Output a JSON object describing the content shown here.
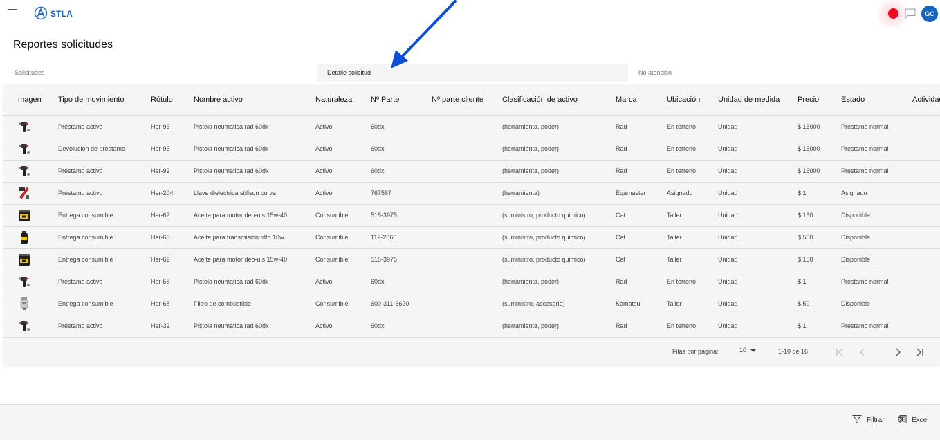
{
  "app": {
    "brand": "STLA",
    "avatar_initials": "GC",
    "accent": "#1565c0",
    "record_color": "#ee0b22"
  },
  "page": {
    "title": "Reportes solicitudes"
  },
  "tabs": [
    {
      "label": "Solicitudes",
      "active": false
    },
    {
      "label": "Detalle solicitud",
      "active": true
    },
    {
      "label": "No atención",
      "active": false
    }
  ],
  "table": {
    "columns": [
      "Imagen",
      "Tipo de movimiento",
      "Rótulo",
      "Nombre activo",
      "Naturaleza",
      "Nº Parte",
      "Nº parte cliente",
      "Clasificación de activo",
      "Marca",
      "Ubicación",
      "Unidad de medida",
      "Precio",
      "Estado",
      "Actividad"
    ],
    "rows": [
      {
        "image": "pneumatic-gun",
        "tipo": "Préstamo activo",
        "rotulo": "Her-93",
        "nombre": "Pistola neumatica rad 60dx",
        "naturaleza": "Activo",
        "parte": "60dx",
        "parte_cliente": "",
        "clasificacion": "(herramienta, poder)",
        "marca": "Rad",
        "ubicacion": "En terreno",
        "unidad": "Unidad",
        "precio": "$ 15000",
        "estado": "Prestamo normal"
      },
      {
        "image": "pneumatic-gun",
        "tipo": "Devolución de préstamo",
        "rotulo": "Her-93",
        "nombre": "Pistola neumatica rad 60dx",
        "naturaleza": "Activo",
        "parte": "60dx",
        "parte_cliente": "",
        "clasificacion": "(herramienta, poder)",
        "marca": "Rad",
        "ubicacion": "En terreno",
        "unidad": "Unidad",
        "precio": "$ 15000",
        "estado": "Prestamo normal"
      },
      {
        "image": "pneumatic-gun",
        "tipo": "Préstamo activo",
        "rotulo": "Her-92",
        "nombre": "Pistola neumatica rad 60dx",
        "naturaleza": "Activo",
        "parte": "60dx",
        "parte_cliente": "",
        "clasificacion": "(herramienta, poder)",
        "marca": "Rad",
        "ubicacion": "En terreno",
        "unidad": "Unidad",
        "precio": "$ 15000",
        "estado": "Prestamo normal"
      },
      {
        "image": "wrench",
        "tipo": "Préstamo activo",
        "rotulo": "Her-204",
        "nombre": "Llave dielectrica stillson curva",
        "naturaleza": "Activo",
        "parte": "767587",
        "parte_cliente": "",
        "clasificacion": "(herramienta)",
        "marca": "Egamaster",
        "ubicacion": "Asignado",
        "unidad": "Unidad",
        "precio": "$ 1",
        "estado": "Asignado"
      },
      {
        "image": "oil-bucket",
        "tipo": "Entrega consumible",
        "rotulo": "Her-62",
        "nombre": "Aceite para motor deo-uls 15w-40",
        "naturaleza": "Consumible",
        "parte": "515-3975",
        "parte_cliente": "",
        "clasificacion": "(suministro, producto quimico)",
        "marca": "Cat",
        "ubicacion": "Taller",
        "unidad": "Unidad",
        "precio": "$ 150",
        "estado": "Disponible"
      },
      {
        "image": "oil-bottle",
        "tipo": "Entrega consumible",
        "rotulo": "Her-63",
        "nombre": "Aceite para transmision tdto 10w",
        "naturaleza": "Consumible",
        "parte": "112-2866",
        "parte_cliente": "",
        "clasificacion": "(suministro, producto quimico)",
        "marca": "Cat",
        "ubicacion": "Taller",
        "unidad": "Unidad",
        "precio": "$ 500",
        "estado": "Disponible"
      },
      {
        "image": "oil-bucket",
        "tipo": "Entrega consumible",
        "rotulo": "Her-62",
        "nombre": "Aceite para motor deo-uls 15w-40",
        "naturaleza": "Consumible",
        "parte": "515-3975",
        "parte_cliente": "",
        "clasificacion": "(suministro, producto quimico)",
        "marca": "Cat",
        "ubicacion": "Taller",
        "unidad": "Unidad",
        "precio": "$ 150",
        "estado": "Disponible"
      },
      {
        "image": "pneumatic-gun",
        "tipo": "Préstamo activo",
        "rotulo": "Her-58",
        "nombre": "Pistola neumatica rad 60dx",
        "naturaleza": "Activo",
        "parte": "60dx",
        "parte_cliente": "",
        "clasificacion": "(herramienta, poder)",
        "marca": "Rad",
        "ubicacion": "En terreno",
        "unidad": "Unidad",
        "precio": "$ 1",
        "estado": "Prestamo normal"
      },
      {
        "image": "fuel-filter",
        "tipo": "Entrega consumible",
        "rotulo": "Her-68",
        "nombre": "Filtro de combustible",
        "naturaleza": "Consumible",
        "parte": "600-311-3620",
        "parte_cliente": "",
        "clasificacion": "(suministro, accesorio)",
        "marca": "Komatsu",
        "ubicacion": "Taller",
        "unidad": "Unidad",
        "precio": "$ 50",
        "estado": "Disponible"
      },
      {
        "image": "pneumatic-gun",
        "tipo": "Préstamo activo",
        "rotulo": "Her-32",
        "nombre": "Pistola neumatica rad 60dx",
        "naturaleza": "Activo",
        "parte": "60dx",
        "parte_cliente": "",
        "clasificacion": "(herramienta, poder)",
        "marca": "Rad",
        "ubicacion": "En terreno",
        "unidad": "Unidad",
        "precio": "$ 1",
        "estado": "Prestamo normal"
      }
    ]
  },
  "pagination": {
    "rows_label": "Filas por página:",
    "rows_per_page": "10",
    "range": "1-10 de 16"
  },
  "footer": {
    "filter_label": "Filtrar",
    "excel_label": "Excel"
  },
  "annotation": {
    "arrow_color": "#0b4fd8"
  }
}
